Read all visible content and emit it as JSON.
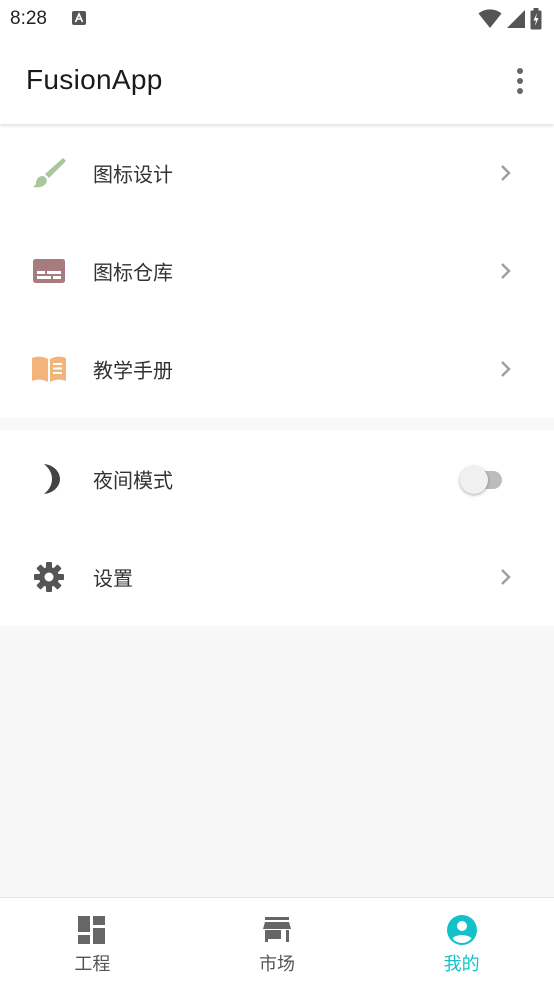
{
  "status_bar": {
    "time": "8:28"
  },
  "app_bar": {
    "title": "FusionApp"
  },
  "menu_group_1": [
    {
      "label": "图标设计",
      "icon": "paint-brush-icon"
    },
    {
      "label": "图标仓库",
      "icon": "icon-repository-icon"
    },
    {
      "label": "教学手册",
      "icon": "open-book-icon"
    }
  ],
  "menu_group_2": [
    {
      "label": "夜间模式",
      "icon": "moon-icon",
      "toggle": false
    },
    {
      "label": "设置",
      "icon": "gear-icon"
    }
  ],
  "bottom_nav": {
    "items": [
      {
        "label": "工程",
        "icon": "dashboard-icon",
        "active": false
      },
      {
        "label": "市场",
        "icon": "store-icon",
        "active": false
      },
      {
        "label": "我的",
        "icon": "account-icon",
        "active": true
      }
    ]
  },
  "colors": {
    "accent": "#12c2c8",
    "brush": "#a9c79a",
    "repository": "#a67c7e",
    "book": "#f2b47a",
    "neutral_icon": "#555555"
  }
}
